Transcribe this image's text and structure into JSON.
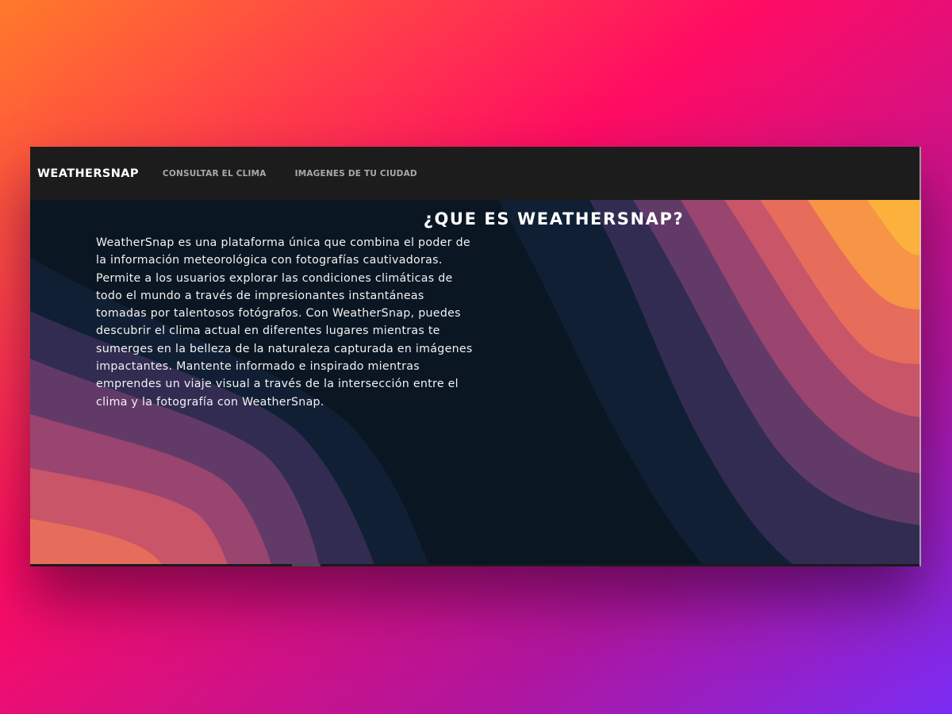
{
  "nav": {
    "brand": "WEATHERSNAP",
    "links": [
      "CONSULTAR EL CLIMA",
      "IMAGENES DE TU CIUDAD"
    ]
  },
  "main": {
    "heading": "¿QUE ES WEATHERSNAP?",
    "description": "WeatherSnap es una plataforma única que combina el poder de la información meteorológica con fotografías cautivadoras. Permite a los usuarios explorar las condiciones climáticas de todo el mundo a través de impresionantes instantáneas tomadas por talentosos fotógrafos. Con WeatherSnap, puedes descubrir el clima actual en diferentes lugares mientras te sumerges en la belleza de la naturaleza capturada en imágenes impactantes. Mantente informado e inspirado mientras emprendes un viaje visual a través de la intersección entre el clima y la fotografía con WeatherSnap."
  },
  "colors": {
    "background_gradient": [
      "#ff6a2b",
      "#ff0066",
      "#7b2ff7"
    ],
    "navbar": "#1c1c1c",
    "hero_base": "#0a1622",
    "wave_palette": [
      "#fbb13c",
      "#f89446",
      "#e66d5b",
      "#c85568",
      "#9a4470",
      "#623a68",
      "#322c52",
      "#101f33"
    ]
  }
}
